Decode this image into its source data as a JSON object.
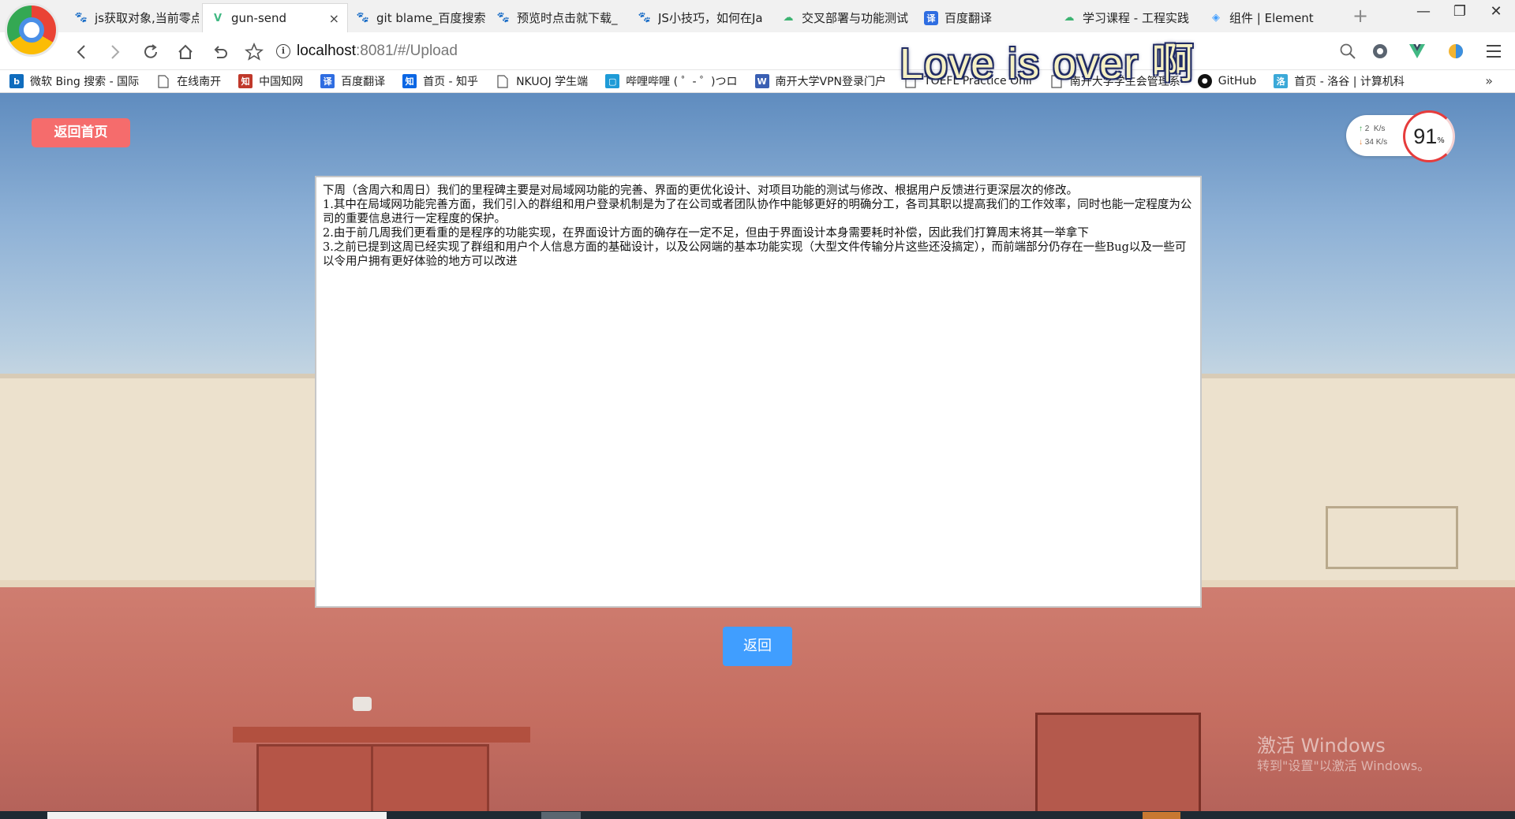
{
  "browser": {
    "tabs": [
      {
        "label": "js获取对象,当前零点",
        "icon": "paw-icon",
        "active": false
      },
      {
        "label": "gun-send",
        "icon": "vue-icon",
        "active": true
      },
      {
        "label": "git blame_百度搜索",
        "icon": "paw-icon",
        "active": false
      },
      {
        "label": "预览时点击就下载_",
        "icon": "paw-icon",
        "active": false
      },
      {
        "label": "JS小技巧，如何在Ja",
        "icon": "paw-icon",
        "active": false
      },
      {
        "label": "交叉部署与功能测试",
        "icon": "cloud-icon",
        "active": false
      },
      {
        "label": "百度翻译",
        "icon": "translate-icon",
        "active": false
      },
      {
        "label": "学习课程 - 工程实践",
        "icon": "cloud-icon",
        "active": false
      },
      {
        "label": "组件 | Element",
        "icon": "element-icon",
        "active": false
      }
    ],
    "tab_close": "×",
    "new_tab": "+",
    "window_controls": {
      "minimize": "—",
      "restore": "❐",
      "close": "✕"
    },
    "url": {
      "host": "localhost",
      "path": ":8081/#/Upload"
    },
    "overlay_lyrics": "Love is over 啊",
    "bookmarks": [
      {
        "label": "微软 Bing 搜索 - 国际",
        "icon": "bing-icon",
        "color": "#0f6cbd"
      },
      {
        "label": "在线南开",
        "icon": "page-icon",
        "color": ""
      },
      {
        "label": "中国知网",
        "icon": "cnki-icon",
        "color": "#c0392b"
      },
      {
        "label": "百度翻译",
        "icon": "translate-icon",
        "color": "#2f6de1"
      },
      {
        "label": "首页 - 知乎",
        "icon": "zhihu-icon",
        "color": "#0a66e4"
      },
      {
        "label": "NKUOJ 学生端",
        "icon": "page-icon",
        "color": ""
      },
      {
        "label": "哔哩哔哩 ( ゜- ゜)つロ",
        "icon": "bilibili-icon",
        "color": "#1e9bd7"
      },
      {
        "label": "南开大学VPN登录门户",
        "icon": "vpn-icon",
        "color": "#3a5fb3"
      },
      {
        "label": "TOEFL Practice Onli",
        "icon": "page-icon",
        "color": ""
      },
      {
        "label": "南开大学学生会管理系",
        "icon": "page-icon",
        "color": ""
      },
      {
        "label": "GitHub",
        "icon": "github-icon",
        "color": "#111111"
      },
      {
        "label": "首页 - 洛谷 | 计算机科",
        "icon": "luogu-icon",
        "color": "#3ba9d8"
      }
    ],
    "bookmarks_more": "»"
  },
  "page": {
    "home_button": "返回首页",
    "back_button": "返回",
    "report_text": "下周（含周六和周日）我们的里程碑主要是对局域网功能的完善、界面的更优化设计、对项目功能的测试与修改、根据用户反馈进行更深层次的修改。\n1.其中在局域网功能完善方面，我们引入的群组和用户登录机制是为了在公司或者团队协作中能够更好的明确分工，各司其职以提高我们的工作效率，同时也能一定程度为公司的重要信息进行一定程度的保护。\n2.由于前几周我们更看重的是程序的功能实现，在界面设计方面的确存在一定不足，但由于界面设计本身需要耗时补偿，因此我们打算周末将其一举拿下\n3.之前已提到这周已经实现了群组和用户个人信息方面的基础设计，以及公网端的基本功能实现（大型文件传输分片这些还没搞定），而前端部分仍存在一些Bug以及一些可以令用户拥有更好体验的地方可以改进",
    "net_widget": {
      "up_value": "2",
      "down_value": "34",
      "unit": "K/s",
      "gauge_value": "91",
      "gauge_unit": "%"
    },
    "watermark": {
      "title": "激活 Windows",
      "subtitle": "转到\"设置\"以激活 Windows。"
    }
  },
  "colors": {
    "home_button": "#f56c6c",
    "back_button": "#409eff"
  }
}
